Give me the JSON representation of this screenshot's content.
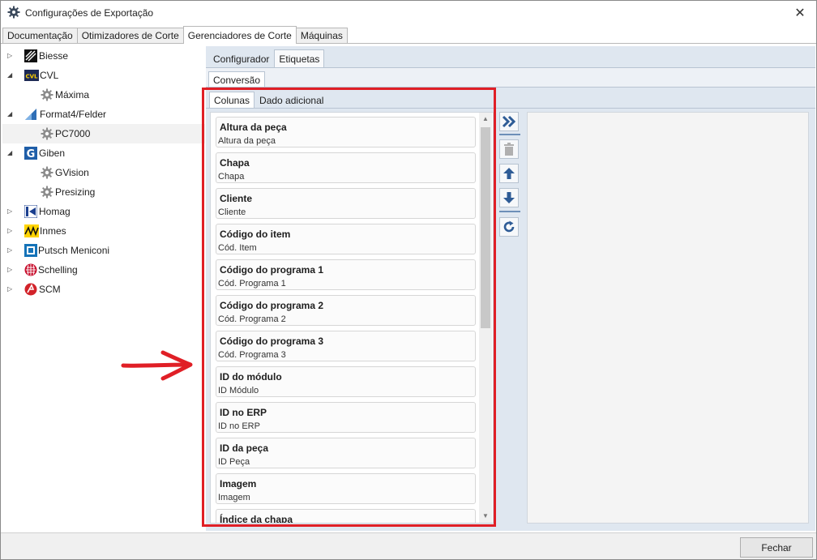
{
  "window": {
    "title": "Configurações de Exportação",
    "close_symbol": "✕"
  },
  "top_tabs": [
    {
      "label": "Documentação",
      "active": false
    },
    {
      "label": "Otimizadores de Corte",
      "active": false
    },
    {
      "label": "Gerenciadores de Corte",
      "active": true
    },
    {
      "label": "Máquinas",
      "active": false
    }
  ],
  "tree": [
    {
      "label": "Biesse",
      "expander": "▷",
      "icon": "biesse-logo-icon",
      "level": 0
    },
    {
      "label": "CVL",
      "expander": "◢",
      "icon": "cvl-logo-icon",
      "level": 0
    },
    {
      "label": "Máxima",
      "expander": "",
      "icon": "gear-icon",
      "level": 1
    },
    {
      "label": "Format4/Felder",
      "expander": "◢",
      "icon": "format4-logo-icon",
      "level": 0
    },
    {
      "label": "PC7000",
      "expander": "",
      "icon": "gear-icon",
      "level": 1,
      "selected": true
    },
    {
      "label": "Giben",
      "expander": "◢",
      "icon": "giben-logo-icon",
      "level": 0
    },
    {
      "label": "GVision",
      "expander": "",
      "icon": "gear-icon",
      "level": 1
    },
    {
      "label": "Presizing",
      "expander": "",
      "icon": "gear-icon",
      "level": 1
    },
    {
      "label": "Homag",
      "expander": "▷",
      "icon": "homag-logo-icon",
      "level": 0
    },
    {
      "label": "Inmes",
      "expander": "▷",
      "icon": "inmes-logo-icon",
      "level": 0
    },
    {
      "label": "Putsch Meniconi",
      "expander": "▷",
      "icon": "putsch-logo-icon",
      "level": 0
    },
    {
      "label": "Schelling",
      "expander": "▷",
      "icon": "schelling-logo-icon",
      "level": 0
    },
    {
      "label": "SCM",
      "expander": "▷",
      "icon": "scm-logo-icon",
      "level": 0
    }
  ],
  "sub_tabs": [
    {
      "label": "Configurador",
      "active": false
    },
    {
      "label": "Etiquetas",
      "active": true
    }
  ],
  "conversion_tab": "Conversão",
  "inner_tabs": [
    {
      "label": "Colunas",
      "active": true
    },
    {
      "label": "Dado adicional",
      "active": false
    }
  ],
  "columns": [
    {
      "title": "Altura da peça",
      "subtitle": "Altura da peça"
    },
    {
      "title": "Chapa",
      "subtitle": "Chapa"
    },
    {
      "title": "Cliente",
      "subtitle": "Cliente"
    },
    {
      "title": "Código do item",
      "subtitle": "Cód. Item"
    },
    {
      "title": "Código do programa 1",
      "subtitle": "Cód. Programa 1"
    },
    {
      "title": "Código do programa 2",
      "subtitle": "Cód. Programa 2"
    },
    {
      "title": "Código do programa 3",
      "subtitle": "Cód. Programa 3"
    },
    {
      "title": "ID do módulo",
      "subtitle": "ID Módulo"
    },
    {
      "title": "ID no ERP",
      "subtitle": "ID no ERP"
    },
    {
      "title": "ID da peça",
      "subtitle": "ID Peça"
    },
    {
      "title": "Imagem",
      "subtitle": "Imagem"
    },
    {
      "title": "Índice da chapa",
      "subtitle": ""
    }
  ],
  "toolbar_icons": [
    "add-all-icon",
    "delete-icon",
    "move-up-icon",
    "move-down-icon",
    "refresh-icon"
  ],
  "footer": {
    "close_label": "Fechar"
  },
  "colors": {
    "accent": "#2e5c96",
    "highlight": "#e01f26",
    "panel_bg": "#dfe7f0"
  }
}
